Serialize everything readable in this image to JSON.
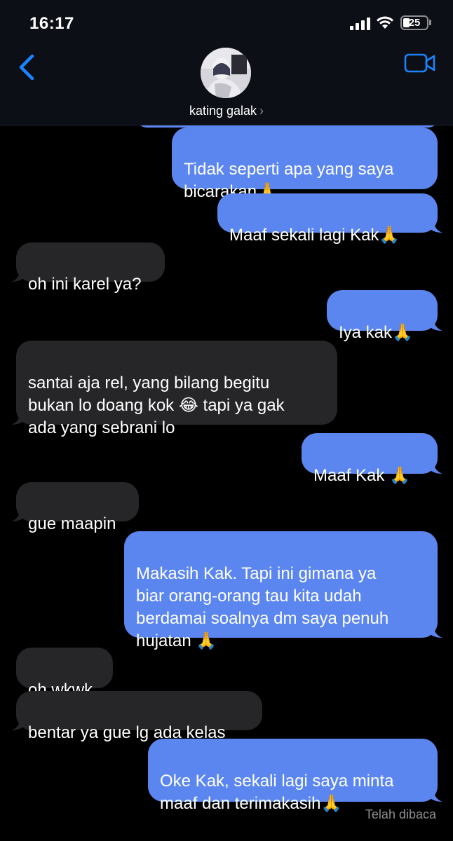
{
  "status_bar": {
    "time": "16:17",
    "battery": "25"
  },
  "header": {
    "contact_name": "kating galak",
    "chevron": "›"
  },
  "messages": [
    {
      "dir": "sent",
      "text": "Tidak seperti apa yang saya\nbicarakan🙏"
    },
    {
      "dir": "sent",
      "text": "Maaf sekali lagi Kak🙏"
    },
    {
      "dir": "received",
      "text": "oh ini karel ya?"
    },
    {
      "dir": "sent",
      "text": "Iya kak🙏"
    },
    {
      "dir": "received",
      "text": "santai aja rel, yang bilang begitu\nbukan lo doang kok 😂 tapi ya gak\nada yang sebrani lo"
    },
    {
      "dir": "sent",
      "text": "Maaf Kak 🙏"
    },
    {
      "dir": "received",
      "text": "gue maapin"
    },
    {
      "dir": "sent",
      "text": "Makasih Kak. Tapi ini gimana ya\nbiar orang-orang tau kita udah\nberdamai soalnya dm saya penuh\nhujatan 🙏"
    },
    {
      "dir": "received",
      "text": "oh wkwk"
    },
    {
      "dir": "received",
      "text": "bentar ya gue lg ada kelas"
    },
    {
      "dir": "sent",
      "text": "Oke Kak, sekali lagi saya minta\nmaaf dan terimakasih🙏"
    }
  ],
  "read_receipt": "Telah dibaca",
  "colors": {
    "sent_bubble": "#5b86f0",
    "received_bubble": "#262628",
    "accent": "#1a84ff"
  }
}
